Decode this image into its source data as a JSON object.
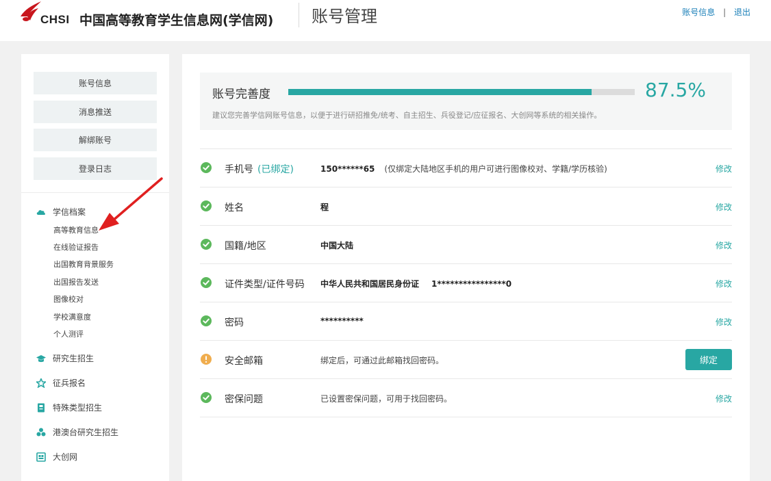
{
  "header": {
    "logo_text": "CHSI",
    "site_name": "中国高等教育学生信息网(学信网)",
    "page_title": "账号管理",
    "links": {
      "account_info": "账号信息",
      "separator": "|",
      "logout": "退出"
    }
  },
  "sidebar": {
    "buttons": [
      "账号信息",
      "消息推送",
      "解绑账号",
      "登录日志"
    ],
    "xueji": {
      "label": "学信档案",
      "items": [
        "高等教育信息",
        "在线验证报告",
        "出国教育背景服务",
        "出国报告发送",
        "图像校对",
        "学校满意度",
        "个人测评"
      ]
    },
    "groups": [
      {
        "label": "研究生招生",
        "icon": "graduation-cap-icon"
      },
      {
        "label": "征兵报名",
        "icon": "star-icon"
      },
      {
        "label": "特殊类型招生",
        "icon": "id-card-icon"
      },
      {
        "label": "港澳台研究生招生",
        "icon": "people-icon"
      },
      {
        "label": "大创网",
        "icon": "grid-box-icon"
      }
    ]
  },
  "completeness": {
    "label": "账号完善度",
    "percent_text": "87.5%",
    "progress": 0.875,
    "tip": "建议您完善学信网账号信息，以便于进行研招推免/统考、自主招生、兵役登记/应征报名、大创网等系统的相关操作。"
  },
  "rows": {
    "phone": {
      "label": "手机号",
      "bound": "(已绑定)",
      "value": "150******65",
      "note": "(仅绑定大陆地区手机的用户可进行图像校对、学籍/学历核验)",
      "action": "修改"
    },
    "name": {
      "label": "姓名",
      "value": "程",
      "action": "修改"
    },
    "region": {
      "label": "国籍/地区",
      "value": "中国大陆",
      "action": "修改"
    },
    "id": {
      "label": "证件类型/证件号码",
      "value": "中华人民共和国居民身份证",
      "value2": "1****************0",
      "action": "修改"
    },
    "password": {
      "label": "密码",
      "value": "**********",
      "action": "修改"
    },
    "email": {
      "label": "安全邮箱",
      "value": "绑定后，可通过此邮箱找回密码。",
      "action": "绑定"
    },
    "question": {
      "label": "密保问题",
      "value": "已设置密保问题，可用于找回密码。",
      "action": "修改"
    }
  },
  "colors": {
    "accent": "#28a7a3",
    "link": "#1a7fb8",
    "success": "#5cb85c",
    "warning": "#f0ad4e",
    "annotation": "#e02020"
  }
}
